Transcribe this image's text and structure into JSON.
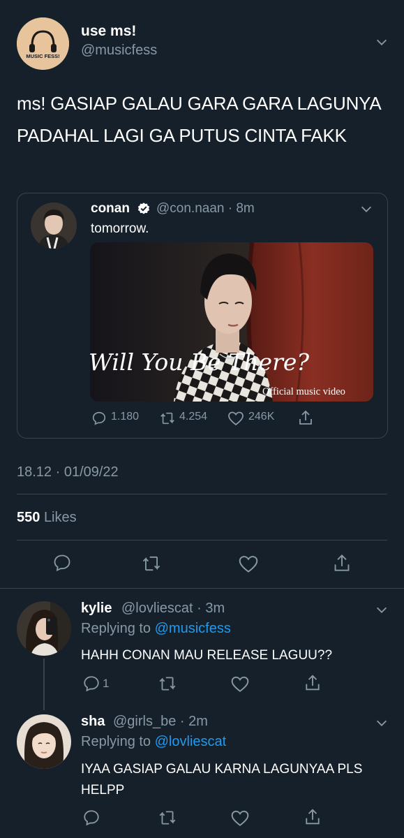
{
  "main_tweet": {
    "display_name": "use ms!",
    "handle": "@musicfess",
    "avatar_logo_text": "MUSIC FESS!",
    "text": "ms! GASIAP GALAU GARA GARA LAGUNYA PADAHAL LAGI GA PUTUS CINTA FAKK",
    "timestamp": "18.12 · 01/09/22",
    "likes_count": "550",
    "likes_label": "Likes"
  },
  "quoted_tweet": {
    "display_name": "conan",
    "handle_time": "@con.naan · 8m",
    "text": "tomorrow.",
    "media_title": "Will You Be There?",
    "media_subtitle": "Official music video",
    "replies": "1.180",
    "retweets": "4.254",
    "likes": "246K"
  },
  "replies": [
    {
      "display_name": "kylie",
      "handle_time": "@lovliescat · 3m",
      "replying_prefix": "Replying to",
      "replying_to": "@musicfess",
      "text": "HAHH CONAN MAU RELEASE LAGUU??",
      "reply_count": "1"
    },
    {
      "display_name": "sha",
      "handle_time": "@girls_be · 2m",
      "replying_prefix": "Replying to",
      "replying_to": "@lovliescat",
      "text": "IYAA GASIAP GALAU KARNA LAGUNYAA PLS HELPP",
      "reply_count": ""
    }
  ],
  "colors": {
    "background": "#15202b",
    "muted": "#8899a6",
    "link": "#1d9bf0",
    "border": "#38444d"
  },
  "icons": [
    "chevron-down-icon",
    "verified-badge-icon",
    "reply-icon",
    "retweet-icon",
    "like-icon",
    "share-icon"
  ]
}
